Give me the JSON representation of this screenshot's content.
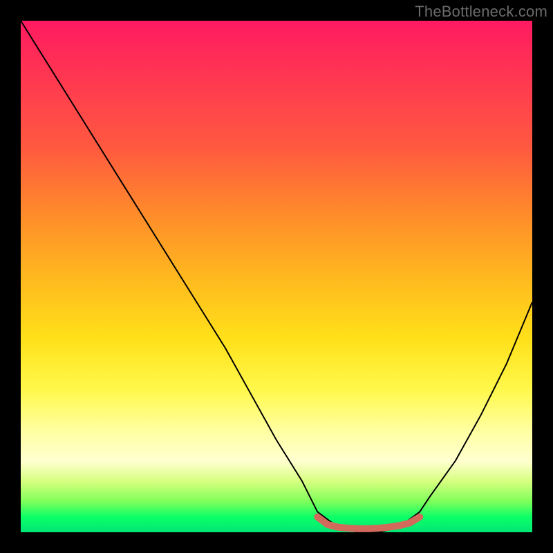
{
  "watermark": "TheBottleneck.com",
  "chart_data": {
    "type": "line",
    "title": "",
    "xlabel": "",
    "ylabel": "",
    "xlim": [
      0,
      100
    ],
    "ylim": [
      0,
      100
    ],
    "grid": false,
    "background_gradient_stops": [
      {
        "pos": 0,
        "color": "#ff1a62"
      },
      {
        "pos": 25,
        "color": "#ff5a3f"
      },
      {
        "pos": 50,
        "color": "#ffb81f"
      },
      {
        "pos": 72,
        "color": "#fff84a"
      },
      {
        "pos": 86,
        "color": "#ffffd0"
      },
      {
        "pos": 94,
        "color": "#7eff5a"
      },
      {
        "pos": 100,
        "color": "#00e676"
      }
    ],
    "series": [
      {
        "name": "bottleneck-curve",
        "color": "#000000",
        "stroke_width": 2,
        "x": [
          0,
          5,
          10,
          15,
          20,
          25,
          30,
          35,
          40,
          45,
          50,
          55,
          58,
          62,
          66,
          70,
          74,
          78,
          80,
          85,
          90,
          95,
          100
        ],
        "values": [
          100,
          92,
          84,
          76,
          68,
          60,
          52,
          44,
          36,
          27,
          18,
          10,
          4,
          1,
          0,
          0,
          1,
          4,
          7,
          14,
          23,
          33,
          45
        ]
      },
      {
        "name": "optimal-zone-marker",
        "color": "#d26a5c",
        "stroke_width": 10,
        "linecap": "round",
        "x": [
          58,
          60,
          62,
          64,
          66,
          68,
          70,
          72,
          74,
          76,
          78
        ],
        "values": [
          3,
          1.5,
          1,
          0.8,
          0.7,
          0.7,
          0.8,
          1,
          1.3,
          1.8,
          3
        ]
      }
    ]
  }
}
